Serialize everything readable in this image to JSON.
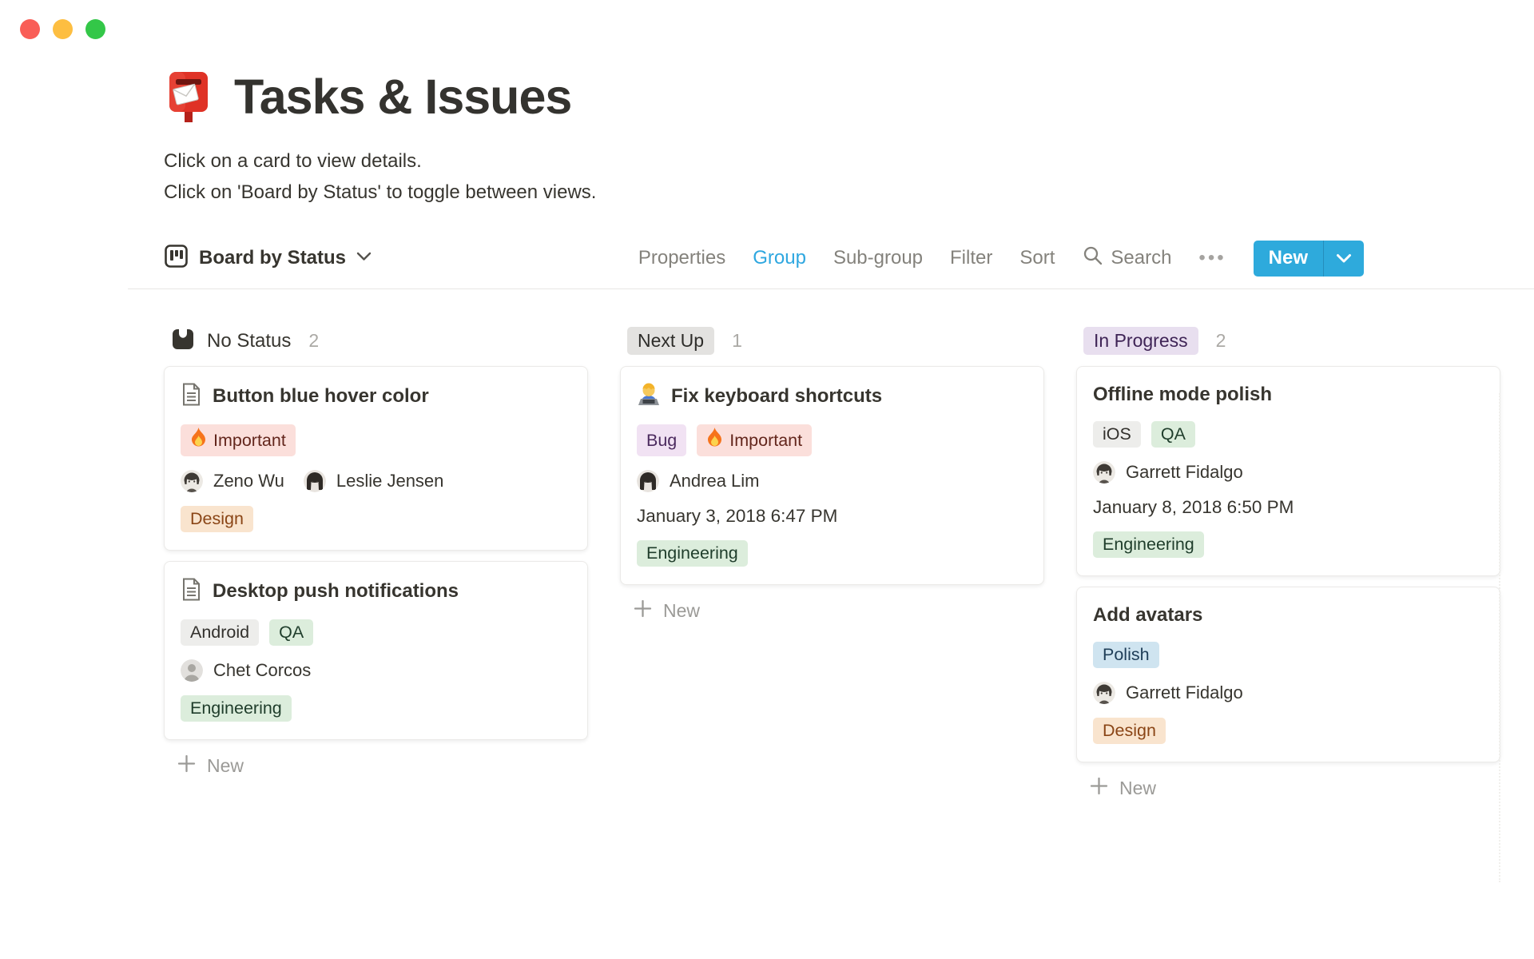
{
  "window": {
    "controls": [
      {
        "name": "close",
        "color": "#F95E57"
      },
      {
        "name": "minimize",
        "color": "#FDBE41"
      },
      {
        "name": "zoom",
        "color": "#33C748"
      }
    ]
  },
  "page": {
    "icon": "postbox-icon",
    "title": "Tasks & Issues",
    "subtitle_line1": "Click on a card to view details.",
    "subtitle_line2": "Click on 'Board by Status' to toggle between views."
  },
  "toolbar": {
    "view_label": "Board by Status",
    "menu": [
      "Properties",
      "Group",
      "Sub-group",
      "Filter",
      "Sort"
    ],
    "active_item": "Group",
    "active_color": "#2EA7E0",
    "search_label": "Search",
    "more_label": "•••",
    "new_button_label": "New",
    "new_button_color": "#2EAADC"
  },
  "tag_colors": {
    "red": {
      "bg": "#FBDFDB",
      "text": "#63261C"
    },
    "orange": {
      "bg": "#F9E4CE",
      "text": "#8A4516"
    },
    "gray": {
      "bg": "#EDEDEB",
      "text": "#32302C"
    },
    "green": {
      "bg": "#DCEDDC",
      "text": "#1F3D2B"
    },
    "purple": {
      "bg": "#F1E2F3",
      "text": "#4B2A5E"
    },
    "blue": {
      "bg": "#CFE4F0",
      "text": "#1F3E58"
    }
  },
  "board": {
    "add_card_label": "New",
    "columns": [
      {
        "header": {
          "type": "plain",
          "icon": "no-status-icon",
          "title": "No Status",
          "count": "2"
        },
        "cards": [
          {
            "icon": "document-icon",
            "title": "Button blue hover color",
            "rows": [
              {
                "type": "tags",
                "tags": [
                  {
                    "label": "Important",
                    "color": "red",
                    "icon": "fire-icon"
                  }
                ]
              },
              {
                "type": "people",
                "people": [
                  {
                    "name": "Zeno Wu",
                    "avatar": "photo-short-hair"
                  },
                  {
                    "name": "Leslie Jensen",
                    "avatar": "photo-long-hair"
                  }
                ]
              },
              {
                "type": "tags",
                "tags": [
                  {
                    "label": "Design",
                    "color": "orange"
                  }
                ]
              }
            ]
          },
          {
            "icon": "document-icon",
            "title": "Desktop push notifications",
            "rows": [
              {
                "type": "tags",
                "tags": [
                  {
                    "label": "Android",
                    "color": "gray"
                  },
                  {
                    "label": "QA",
                    "color": "green"
                  }
                ]
              },
              {
                "type": "people",
                "people": [
                  {
                    "name": "Chet Corcos",
                    "avatar": "default"
                  }
                ]
              },
              {
                "type": "tags",
                "tags": [
                  {
                    "label": "Engineering",
                    "color": "green"
                  }
                ]
              }
            ]
          }
        ]
      },
      {
        "header": {
          "type": "badge",
          "title": "Next Up",
          "count": "1",
          "bg": "#E3E2E0",
          "color": "#2E2D2A"
        },
        "cards": [
          {
            "icon": "technologist-icon",
            "title": "Fix keyboard shortcuts",
            "rows": [
              {
                "type": "tags",
                "tags": [
                  {
                    "label": "Bug",
                    "color": "purple"
                  },
                  {
                    "label": "Important",
                    "color": "red",
                    "icon": "fire-icon"
                  }
                ]
              },
              {
                "type": "people",
                "people": [
                  {
                    "name": "Andrea Lim",
                    "avatar": "photo-long-hair"
                  }
                ]
              },
              {
                "type": "date",
                "text": "January 3, 2018 6:47 PM"
              },
              {
                "type": "tags",
                "tags": [
                  {
                    "label": "Engineering",
                    "color": "green"
                  }
                ]
              }
            ]
          }
        ]
      },
      {
        "header": {
          "type": "badge",
          "title": "In Progress",
          "count": "2",
          "bg": "#E8DFEF",
          "color": "#3F2456"
        },
        "cards": [
          {
            "title": "Offline mode polish",
            "rows": [
              {
                "type": "tags",
                "tags": [
                  {
                    "label": "iOS",
                    "color": "gray"
                  },
                  {
                    "label": "QA",
                    "color": "green"
                  }
                ]
              },
              {
                "type": "people",
                "people": [
                  {
                    "name": "Garrett Fidalgo",
                    "avatar": "photo-short-hair"
                  }
                ]
              },
              {
                "type": "date",
                "text": "January 8, 2018 6:50 PM"
              },
              {
                "type": "tags",
                "tags": [
                  {
                    "label": "Engineering",
                    "color": "green"
                  }
                ]
              }
            ]
          },
          {
            "title": "Add avatars",
            "rows": [
              {
                "type": "tags",
                "tags": [
                  {
                    "label": "Polish",
                    "color": "blue"
                  }
                ]
              },
              {
                "type": "people",
                "people": [
                  {
                    "name": "Garrett Fidalgo",
                    "avatar": "photo-short-hair"
                  }
                ]
              },
              {
                "type": "tags",
                "tags": [
                  {
                    "label": "Design",
                    "color": "orange"
                  }
                ]
              }
            ]
          }
        ]
      }
    ]
  }
}
